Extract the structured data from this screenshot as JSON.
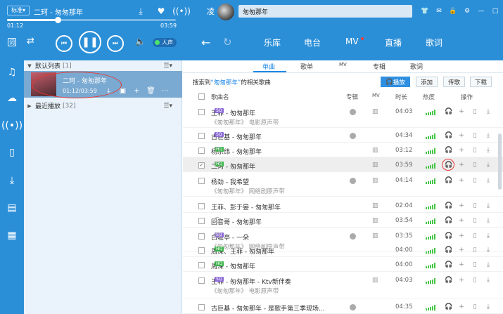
{
  "header": {
    "quality": "标准",
    "now_playing": "二珂 - 匆匆那年",
    "time_elapsed": "01:12",
    "time_total": "03:59",
    "progress": 0.3,
    "mode_pill": "人声",
    "user_initial": "凌",
    "search_value": "匆匆那年",
    "nav_tabs": [
      "乐库",
      "电台",
      "MV",
      "直播",
      "歌词"
    ]
  },
  "playlist": {
    "default_label": "默认列表",
    "default_count": "[1]",
    "current_song": "二珂 - 匆匆那年",
    "current_time": "01:12/03:59",
    "recent_label": "最近播放",
    "recent_count": "[32]"
  },
  "results": {
    "sub_tabs": [
      "单曲",
      "歌单",
      "MV",
      "专辑",
      "歌词"
    ],
    "summary_prefix": "搜索到",
    "summary_query": "“匆匆那年”",
    "summary_suffix": "的相关歌曲",
    "btn_play": "播放",
    "btn_add": "添加",
    "btn_send": "传歌",
    "btn_download": "下载",
    "col_name": "歌曲名",
    "col_album": "专辑",
    "col_mv": "MV",
    "col_duration": "时长",
    "col_heat": "热度",
    "col_actions": "操作",
    "rows": [
      {
        "name": "王菲 - 匆匆那年",
        "badge": "SQ",
        "badge_color": "#8e6bd8",
        "sub": "《匆匆那年》 电影原声带",
        "album": true,
        "mv": true,
        "duration": "04:03",
        "heat": 5,
        "checked": false,
        "globe": false
      },
      {
        "name": "古巨基 - 匆匆那年",
        "badge": "SQ",
        "badge_color": "#8e6bd8",
        "sub": "",
        "album": true,
        "mv": false,
        "duration": "04:34",
        "heat": 5,
        "checked": false,
        "globe": false
      },
      {
        "name": "杨宗纬 - 匆匆那年",
        "badge": "HQ",
        "badge_color": "#3cb44b",
        "sub": "",
        "album": false,
        "mv": true,
        "duration": "03:12",
        "heat": 5,
        "checked": false,
        "globe": true
      },
      {
        "name": "二珂 - 匆匆那年",
        "badge": "HQ",
        "badge_color": "#3cb44b",
        "sub": "",
        "album": false,
        "mv": true,
        "duration": "03:59",
        "heat": 5,
        "checked": true,
        "globe": true
      },
      {
        "name": "杨劲 - 我希望",
        "badge": "",
        "badge_color": "",
        "sub": "《匆匆那年》 网络剧原声带",
        "album": true,
        "mv": true,
        "duration": "04:14",
        "heat": 5,
        "checked": false,
        "globe": false
      },
      {
        "name": "王菲、彭于晏 - 匆匆那年",
        "badge": "",
        "badge_color": "",
        "sub": "",
        "album": false,
        "mv": true,
        "duration": "02:04",
        "heat": 5,
        "checked": false,
        "globe": false
      },
      {
        "name": "回音哥 - 匆匆那年",
        "badge": "",
        "badge_color": "",
        "sub": "",
        "album": false,
        "mv": true,
        "duration": "03:54",
        "heat": 5,
        "checked": false,
        "globe": true
      },
      {
        "name": "白敬亭 - 一朵",
        "badge": "SQ",
        "badge_color": "#8e6bd8",
        "sub": "《匆匆那年》 网络剧原声带",
        "album": true,
        "mv": true,
        "duration": "03:35",
        "heat": 5,
        "checked": false,
        "globe": true
      },
      {
        "name": "周深、王菲 - 匆匆那年",
        "badge": "HQ",
        "badge_color": "#3cb44b",
        "sub": "",
        "album": false,
        "mv": false,
        "duration": "04:00",
        "heat": 5,
        "checked": false,
        "globe": false
      },
      {
        "name": "周深 - 匆匆那年",
        "badge": "HQ",
        "badge_color": "#3cb44b",
        "sub": "",
        "album": false,
        "mv": false,
        "duration": "04:00",
        "heat": 5,
        "checked": false,
        "globe": false
      },
      {
        "name": "王菲 - 匆匆那年 - Ktv新伴奏",
        "badge": "SQ",
        "badge_color": "#8e6bd8",
        "sub": "《匆匆那年》 电影原声带",
        "album": false,
        "mv": true,
        "duration": "04:03",
        "heat": 5,
        "checked": false,
        "globe": false
      },
      {
        "name": "古巨基 - 匆匆那年 - 是歌手第三季现场...",
        "badge": "",
        "badge_color": "",
        "sub": "",
        "album": true,
        "mv": false,
        "duration": "04:35",
        "heat": 5,
        "checked": false,
        "globe": false
      }
    ]
  },
  "colors": {
    "brand": "#2b8fd8",
    "accent": "#1e88e5",
    "heat": "#48c648",
    "highlight": "#e53935"
  }
}
